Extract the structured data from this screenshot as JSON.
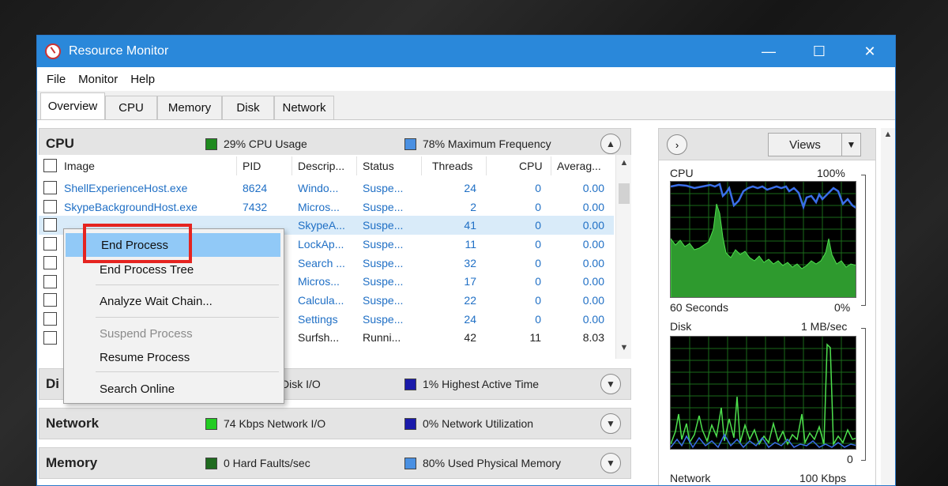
{
  "window": {
    "title": "Resource Monitor",
    "controls": {
      "minimize": "—",
      "maximize": "☐",
      "close": "✕"
    }
  },
  "menu": [
    "File",
    "Monitor",
    "Help"
  ],
  "tabs": [
    "Overview",
    "CPU",
    "Memory",
    "Disk",
    "Network"
  ],
  "active_tab": "Overview",
  "cpu_section": {
    "title": "CPU",
    "metric1": {
      "label": "29% CPU Usage",
      "color": "#1f8a1f"
    },
    "metric2": {
      "label": "78% Maximum Frequency",
      "color": "#4a90e2"
    },
    "collapse_glyph": "▲"
  },
  "table": {
    "columns": [
      "Image",
      "PID",
      "Descrip...",
      "Status",
      "Threads",
      "CPU",
      "Averag..."
    ],
    "rows": [
      {
        "image": "ShellExperienceHost.exe",
        "pid": "8624",
        "desc": "Windo...",
        "status": "Suspe...",
        "threads": "24",
        "cpu": "0",
        "avg": "0.00"
      },
      {
        "image": "SkypeBackgroundHost.exe",
        "pid": "7432",
        "desc": "Micros...",
        "status": "Suspe...",
        "threads": "2",
        "cpu": "0",
        "avg": "0.00"
      },
      {
        "image": "",
        "pid": "",
        "desc": "SkypeA...",
        "status": "Suspe...",
        "threads": "41",
        "cpu": "0",
        "avg": "0.00"
      },
      {
        "image": "",
        "pid": "",
        "desc": "LockAp...",
        "status": "Suspe...",
        "threads": "11",
        "cpu": "0",
        "avg": "0.00"
      },
      {
        "image": "",
        "pid": "",
        "desc": "Search ...",
        "status": "Suspe...",
        "threads": "32",
        "cpu": "0",
        "avg": "0.00"
      },
      {
        "image": "",
        "pid": "",
        "desc": "Micros...",
        "status": "Suspe...",
        "threads": "17",
        "cpu": "0",
        "avg": "0.00"
      },
      {
        "image": "",
        "pid": "",
        "desc": "Calcula...",
        "status": "Suspe...",
        "threads": "22",
        "cpu": "0",
        "avg": "0.00"
      },
      {
        "image": "",
        "pid": "",
        "desc": "Settings",
        "status": "Suspe...",
        "threads": "24",
        "cpu": "0",
        "avg": "0.00"
      },
      {
        "image": "",
        "pid": "",
        "desc": "Surfsh...",
        "status": "Runni...",
        "threads": "42",
        "cpu": "11",
        "avg": "8.03"
      }
    ],
    "selected_row": 2
  },
  "context_menu": {
    "items": [
      "End Process",
      "End Process Tree",
      "Analyze Wait Chain...",
      "Suspend Process",
      "Resume Process",
      "Search Online"
    ],
    "hovered": "End Process",
    "disabled": [
      "Suspend Process"
    ]
  },
  "disk_section": {
    "title": "Di",
    "metric1": {
      "label": "Disk I/O",
      "color": "#1f8a1f"
    },
    "metric2": {
      "label": "1% Highest Active Time",
      "color": "#1a1aaa"
    },
    "collapse_glyph": "▼"
  },
  "network_section": {
    "title": "Network",
    "metric1": {
      "label": "74 Kbps Network I/O",
      "color": "#22cc22"
    },
    "metric2": {
      "label": "0% Network Utilization",
      "color": "#1a1aaa"
    },
    "collapse_glyph": "▼"
  },
  "memory_section": {
    "title": "Memory",
    "metric1": {
      "label": "0 Hard Faults/sec",
      "color": "#1f6a1f"
    },
    "metric2": {
      "label": "80% Used Physical Memory",
      "color": "#4a90e2"
    },
    "collapse_glyph": "▼"
  },
  "right_panel": {
    "expand_glyph": "›",
    "views_label": "Views",
    "views_drop_glyph": "▼",
    "cpu_graph": {
      "label": "CPU",
      "max": "100%",
      "time": "60 Seconds",
      "min": "0%"
    },
    "disk_graph": {
      "label": "Disk",
      "max": "1 MB/sec",
      "min": "0"
    },
    "network_graph": {
      "label": "Network",
      "max": "100 Kbps"
    }
  }
}
